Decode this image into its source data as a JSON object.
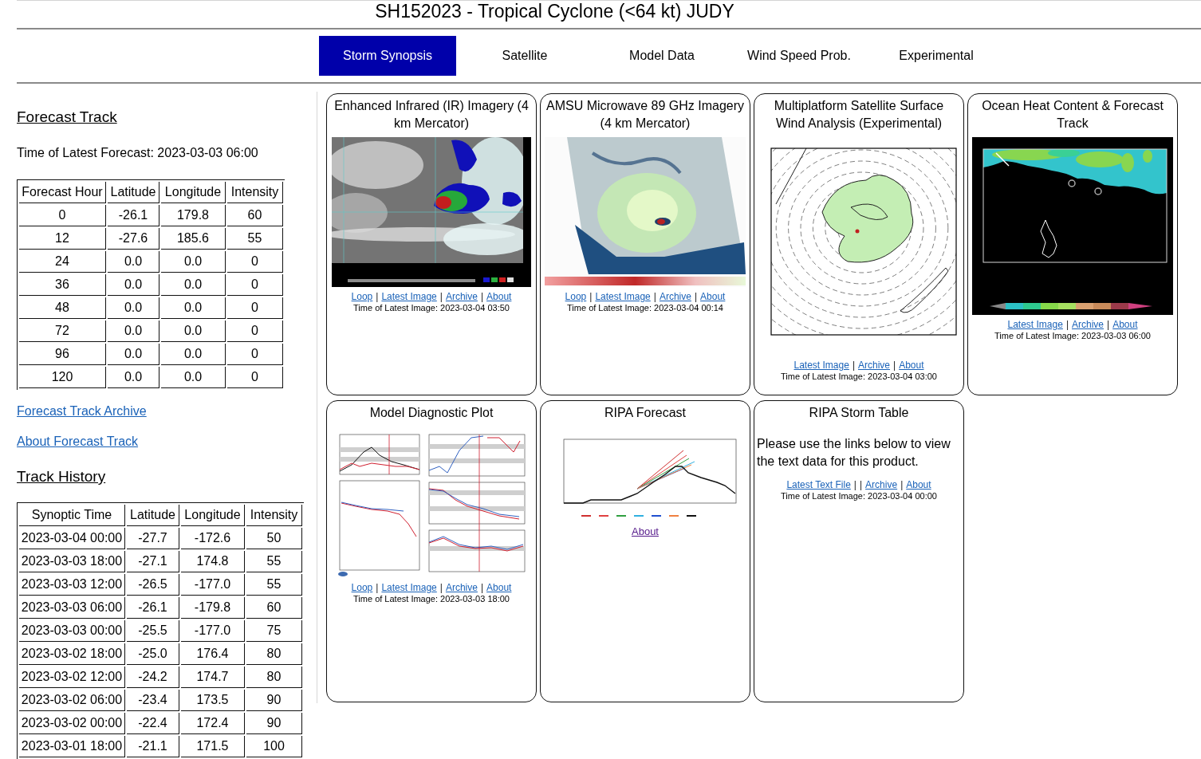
{
  "header": {
    "title": "SH152023 - Tropical Cyclone (<64 kt) JUDY"
  },
  "tabs": [
    {
      "label": "Storm Synopsis",
      "selected": true
    },
    {
      "label": "Satellite",
      "selected": false
    },
    {
      "label": "Model Data",
      "selected": false
    },
    {
      "label": "Wind Speed Prob.",
      "selected": false
    },
    {
      "label": "Experimental",
      "selected": false
    }
  ],
  "forecast_track": {
    "heading": "Forecast Track",
    "latest_forecast": "Time of Latest Forecast: 2023-03-03 06:00",
    "table": {
      "columns": [
        "Forecast Hour",
        "Latitude",
        "Longitude",
        "Intensity"
      ],
      "rows": [
        [
          "0",
          "-26.1",
          "179.8",
          "60"
        ],
        [
          "12",
          "-27.6",
          "185.6",
          "55"
        ],
        [
          "24",
          "0.0",
          "0.0",
          "0"
        ],
        [
          "36",
          "0.0",
          "0.0",
          "0"
        ],
        [
          "48",
          "0.0",
          "0.0",
          "0"
        ],
        [
          "72",
          "0.0",
          "0.0",
          "0"
        ],
        [
          "96",
          "0.0",
          "0.0",
          "0"
        ],
        [
          "120",
          "0.0",
          "0.0",
          "0"
        ]
      ]
    },
    "links": [
      {
        "label": "Forecast Track Archive",
        "visited": false
      },
      {
        "label": "About Forecast Track",
        "visited": false
      }
    ]
  },
  "track_history": {
    "heading": "Track History",
    "table": {
      "columns": [
        "Synoptic Time",
        "Latitude",
        "Longitude",
        "Intensity"
      ],
      "rows": [
        [
          "2023-03-04 00:00",
          "-27.7",
          "-172.6",
          "50"
        ],
        [
          "2023-03-03 18:00",
          "-27.1",
          "174.8",
          "55"
        ],
        [
          "2023-03-03 12:00",
          "-26.5",
          "-177.0",
          "55"
        ],
        [
          "2023-03-03 06:00",
          "-26.1",
          "-179.8",
          "60"
        ],
        [
          "2023-03-03 00:00",
          "-25.5",
          "-177.0",
          "75"
        ],
        [
          "2023-03-02 18:00",
          "-25.0",
          "176.4",
          "80"
        ],
        [
          "2023-03-02 12:00",
          "-24.2",
          "174.7",
          "80"
        ],
        [
          "2023-03-02 06:00",
          "-23.4",
          "173.5",
          "90"
        ],
        [
          "2023-03-02 00:00",
          "-22.4",
          "172.4",
          "90"
        ],
        [
          "2023-03-01 18:00",
          "-21.1",
          "171.5",
          "100"
        ]
      ]
    }
  },
  "products": [
    {
      "kind": "ir_image",
      "title": "Enhanced Infrared (IR) Imagery (4 km Mercator)",
      "links": [
        {
          "kind": "link",
          "label": "Loop",
          "visited": false
        },
        {
          "kind": "separator",
          "label": "|"
        },
        {
          "kind": "link",
          "label": "Latest Image",
          "visited": false
        },
        {
          "kind": "separator",
          "label": "|"
        },
        {
          "kind": "link",
          "label": "Archive",
          "visited": false
        },
        {
          "kind": "separator",
          "label": "|"
        },
        {
          "kind": "link",
          "label": "About",
          "visited": false
        }
      ],
      "latest_image": "Time of Latest Image: 2023-03-04 03:50"
    },
    {
      "kind": "microwave_image",
      "title": "AMSU Microwave 89 GHz Imagery (4 km Mercator)",
      "links": [
        {
          "kind": "link",
          "label": "Loop",
          "visited": false
        },
        {
          "kind": "separator",
          "label": "|"
        },
        {
          "kind": "link",
          "label": "Latest Image",
          "visited": false
        },
        {
          "kind": "separator",
          "label": "|"
        },
        {
          "kind": "link",
          "label": "Archive",
          "visited": false
        },
        {
          "kind": "separator",
          "label": "|"
        },
        {
          "kind": "link",
          "label": "About",
          "visited": false
        }
      ],
      "latest_image": "Time of Latest Image: 2023-03-04 00:14"
    },
    {
      "kind": "wind_analysis",
      "title": "Multiplatform Satellite Surface Wind Analysis (Experimental)",
      "links": [
        {
          "kind": "link",
          "label": "Latest Image",
          "visited": false
        },
        {
          "kind": "separator",
          "label": "|"
        },
        {
          "kind": "link",
          "label": "Archive",
          "visited": false
        },
        {
          "kind": "separator",
          "label": "|"
        },
        {
          "kind": "link",
          "label": "About",
          "visited": false
        }
      ],
      "latest_image": "Time of Latest Image: 2023-03-04 03:00"
    },
    {
      "kind": "ohc_map",
      "title": "Ocean Heat Content & Forecast Track",
      "links": [
        {
          "kind": "link",
          "label": "Latest Image",
          "visited": false
        },
        {
          "kind": "separator",
          "label": "|"
        },
        {
          "kind": "link",
          "label": "Archive",
          "visited": false
        },
        {
          "kind": "separator",
          "label": "|"
        },
        {
          "kind": "link",
          "label": "About",
          "visited": false
        }
      ],
      "latest_image": "Time of Latest Image: 2023-03-03 06:00"
    },
    {
      "kind": "diagnostic_plot",
      "title": "Model Diagnostic Plot",
      "links": [
        {
          "kind": "link",
          "label": "Loop",
          "visited": false
        },
        {
          "kind": "separator",
          "label": "|"
        },
        {
          "kind": "link",
          "label": "Latest Image",
          "visited": false
        },
        {
          "kind": "separator",
          "label": "|"
        },
        {
          "kind": "link",
          "label": "Archive",
          "visited": false
        },
        {
          "kind": "separator",
          "label": "|"
        },
        {
          "kind": "link",
          "label": "About",
          "visited": false
        }
      ],
      "latest_image": "Time of Latest Image: 2023-03-03 18:00"
    },
    {
      "kind": "ripa_plot",
      "title": "RIPA Forecast",
      "links": [
        {
          "kind": "link",
          "label": "About",
          "visited": true
        }
      ]
    },
    {
      "kind": "text_product",
      "title": "RIPA Storm Table",
      "description": "Please use the links below to view the text data for this product.",
      "links": [
        {
          "kind": "link",
          "label": "Latest Text File",
          "visited": false
        },
        {
          "kind": "separator",
          "label": "|"
        },
        {
          "kind": "separator",
          "label": "|"
        },
        {
          "kind": "link",
          "label": "Archive",
          "visited": false
        },
        {
          "kind": "separator",
          "label": "|"
        },
        {
          "kind": "link",
          "label": "About",
          "visited": false
        }
      ],
      "latest_image": "Time of Latest Image: 2023-03-04 00:00"
    }
  ]
}
